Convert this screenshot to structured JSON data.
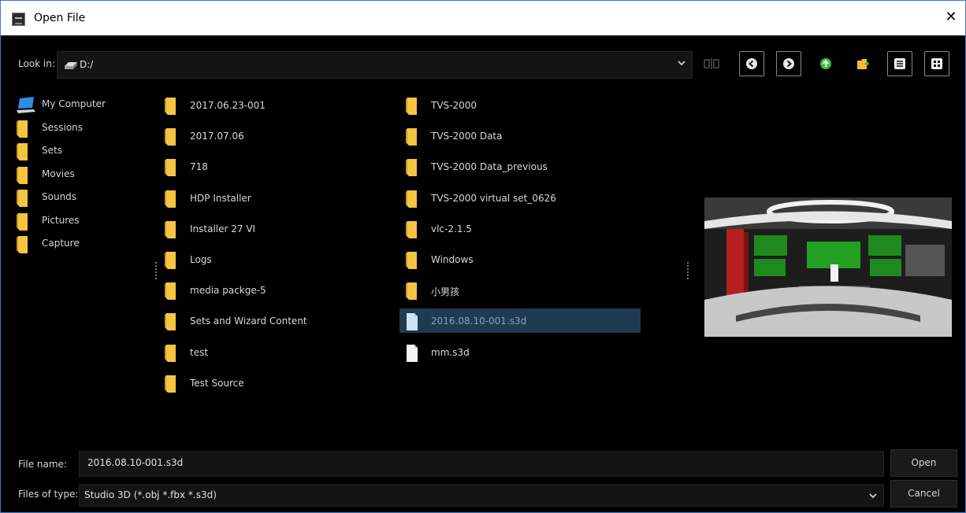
{
  "window": {
    "title": "Open File",
    "close_glyph": "✕"
  },
  "toolbar": {
    "look_in_label": "Look in:",
    "look_in_value": "D:/",
    "buttons": [
      "disk-link-icon",
      "back-icon",
      "forward-icon",
      "up-folder-icon",
      "new-folder-icon",
      "list-view-icon",
      "detail-view-icon"
    ]
  },
  "sidebar": {
    "items": [
      {
        "label": "My Computer",
        "icon": "computer-icon"
      },
      {
        "label": "Sessions",
        "icon": "folder-icon"
      },
      {
        "label": "Sets",
        "icon": "folder-icon"
      },
      {
        "label": "Movies",
        "icon": "folder-icon"
      },
      {
        "label": "Sounds",
        "icon": "folder-icon"
      },
      {
        "label": "Pictures",
        "icon": "folder-icon"
      },
      {
        "label": "Capture",
        "icon": "folder-icon"
      }
    ]
  },
  "files": {
    "col1": [
      {
        "label": "2017.06.23-001",
        "icon": "folder-icon"
      },
      {
        "label": "2017.07.06",
        "icon": "folder-icon"
      },
      {
        "label": "718",
        "icon": "folder-icon"
      },
      {
        "label": "HDP Installer",
        "icon": "folder-icon"
      },
      {
        "label": "Installer 27 VI",
        "icon": "folder-icon"
      },
      {
        "label": "Logs",
        "icon": "folder-icon"
      },
      {
        "label": "media packge-5",
        "icon": "folder-icon"
      },
      {
        "label": "Sets and Wizard Content",
        "icon": "folder-icon"
      },
      {
        "label": "test",
        "icon": "folder-icon"
      },
      {
        "label": "Test Source",
        "icon": "folder-icon"
      }
    ],
    "col2": [
      {
        "label": "TVS-2000",
        "icon": "folder-icon"
      },
      {
        "label": "TVS-2000 Data",
        "icon": "folder-icon"
      },
      {
        "label": "TVS-2000 Data_previous",
        "icon": "folder-icon"
      },
      {
        "label": "TVS-2000 virtual set_0626",
        "icon": "folder-icon"
      },
      {
        "label": "vlc-2.1.5",
        "icon": "folder-icon"
      },
      {
        "label": "Windows",
        "icon": "folder-icon"
      },
      {
        "label": "小男孩",
        "icon": "folder-icon"
      },
      {
        "label": "2016.08.10-001.s3d",
        "icon": "file-icon",
        "selected": true
      },
      {
        "label": "mm.s3d",
        "icon": "file-icon"
      }
    ]
  },
  "footer": {
    "file_name_label": "File name:",
    "file_name_value": "2016.08.10-001.s3d",
    "file_type_label": "Files of type:",
    "file_type_value": "Studio 3D (*.obj *.fbx *.s3d)",
    "open_label": "Open",
    "cancel_label": "Cancel"
  },
  "colors": {
    "accent": "#3a7bd5",
    "selection": "#1e3b52",
    "folder": "#f5c542",
    "background": "#000000"
  }
}
